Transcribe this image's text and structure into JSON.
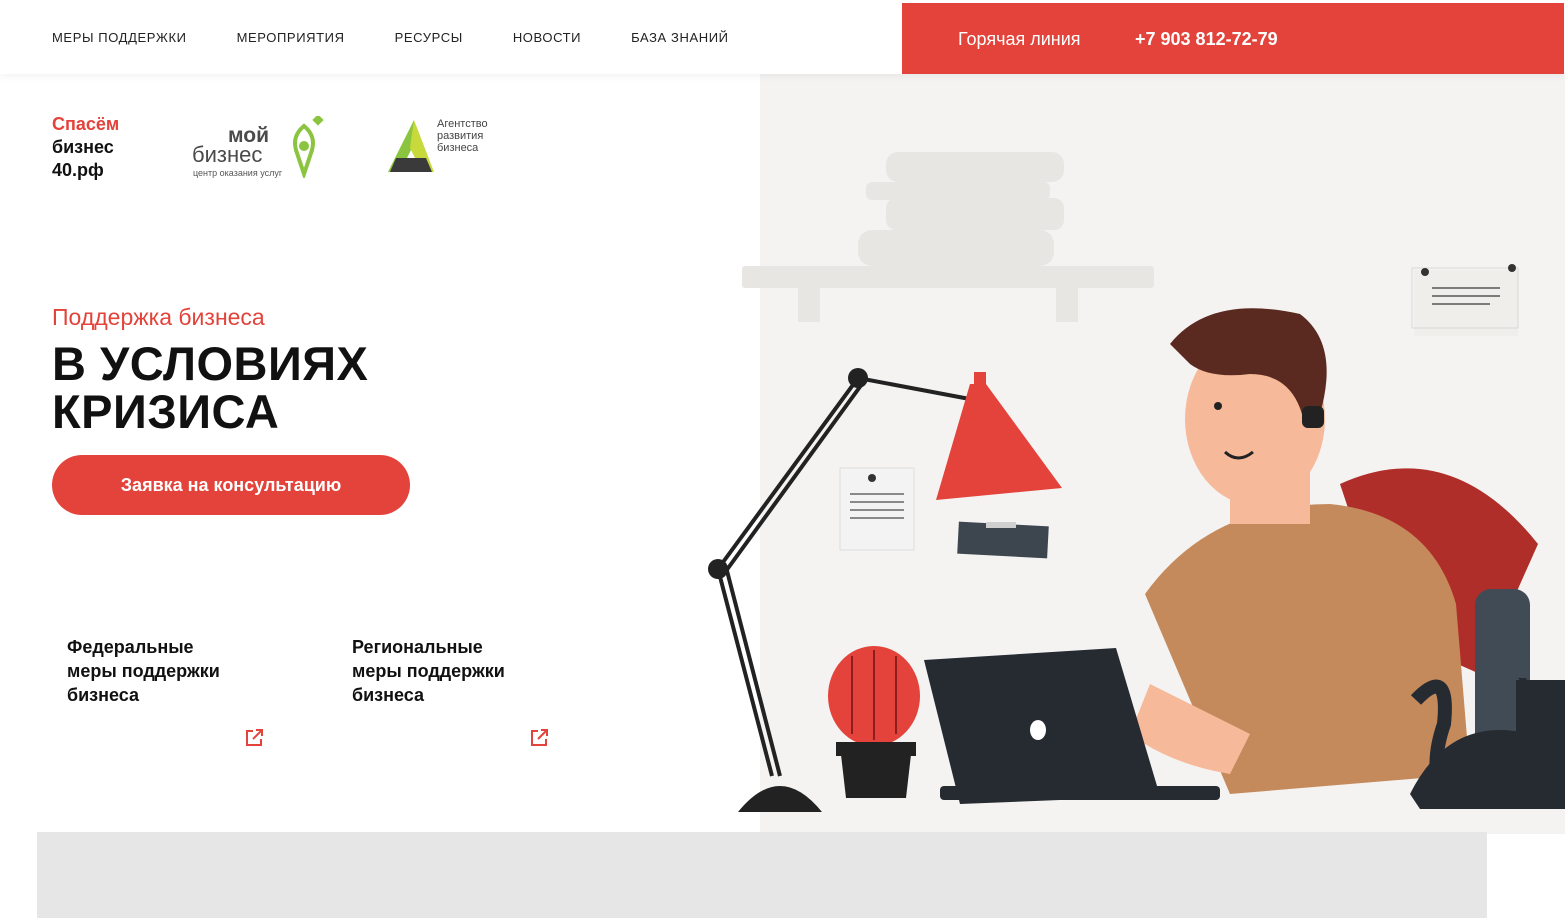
{
  "nav": {
    "items": [
      "Меры поддержки",
      "Мероприятия",
      "Ресурсы",
      "Новости",
      "База знаний"
    ]
  },
  "hotline": {
    "label": "Горячая линия",
    "phone": "+7 903 812-72-79"
  },
  "logos": {
    "spasem": [
      "Спасём",
      "бизнес",
      "40.рф"
    ],
    "moy_biznes": {
      "line1": "мой",
      "line2": "бизнес",
      "tagline": "центр оказания услуг"
    },
    "agency": [
      "Агентство",
      "развития",
      "бизнеса"
    ]
  },
  "hero": {
    "subtitle": "Поддержка бизнеса",
    "title_line1": "В УСЛОВИЯХ",
    "title_line2": "КРИЗИСА",
    "cta_label": "Заявка на консультацию"
  },
  "cards": [
    {
      "line1": "Федеральные",
      "line2": "меры поддержки",
      "line3": "бизнеса"
    },
    {
      "line1": "Региональные",
      "line2": "меры поддержки",
      "line3": "бизнеса"
    }
  ],
  "icons": {
    "external": "external-link-icon",
    "pin": "location-pin-icon"
  },
  "colors": {
    "accent": "#e3433a",
    "green": "#8bc540",
    "panel": "#f4f3f2"
  }
}
